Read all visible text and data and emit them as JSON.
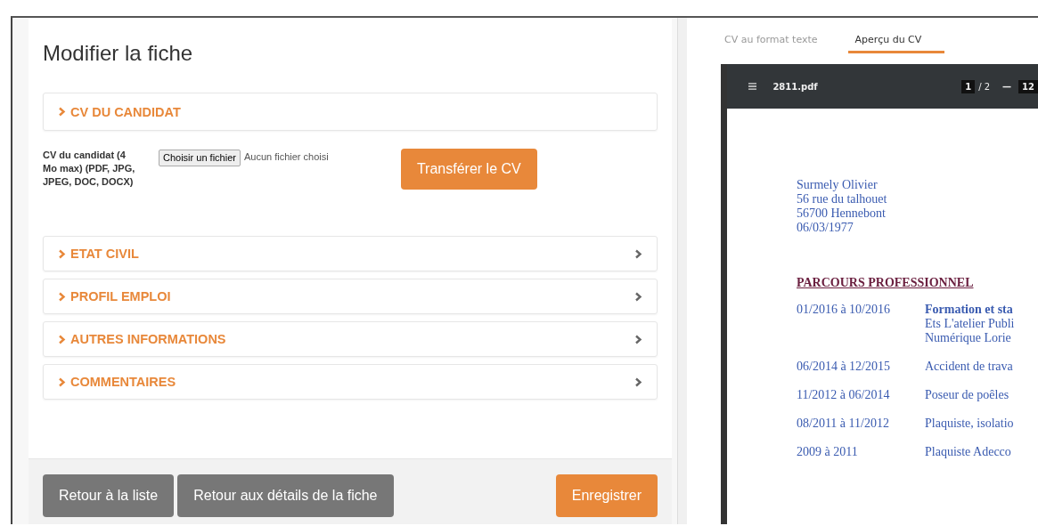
{
  "form": {
    "title": "Modifier la fiche",
    "sections": [
      {
        "label": "CV DU CANDIDAT",
        "expanded": true
      },
      {
        "label": "ETAT CIVIL",
        "expanded": false
      },
      {
        "label": "PROFIL EMPLOI",
        "expanded": false
      },
      {
        "label": "AUTRES INFORMATIONS",
        "expanded": false
      },
      {
        "label": "COMMENTAIRES",
        "expanded": false
      }
    ],
    "upload": {
      "label": "CV du candidat (4 Mo max) (PDF, JPG, JPEG, DOC, DOCX)",
      "choose_button": "Choisir un fichier",
      "file_status": "Aucun fichier choisi",
      "transfer_button": "Transférer le CV"
    },
    "footer_buttons": [
      {
        "label": "Retour à la liste",
        "kind": "secondary"
      },
      {
        "label": "Retour aux détails de la fiche",
        "kind": "secondary"
      },
      {
        "label": "Enregistrer",
        "kind": "primary"
      }
    ]
  },
  "preview": {
    "tabs": [
      {
        "label": "CV au format texte",
        "selected": false
      },
      {
        "label": "Aperçu du CV",
        "selected": true
      }
    ],
    "viewer": {
      "filename": "2811.pdf",
      "page": "1",
      "page_total": "/ 2",
      "zoom_out": "—",
      "zoom": "12"
    },
    "document": {
      "address": [
        "Surmely Olivier",
        "56 rue du talhouet",
        "56700 Hennebont",
        "06/03/1977"
      ],
      "heading": "PARCOURS PROFESSIONNEL",
      "entries": [
        {
          "dates": "01/2016 à 10/2016",
          "lines": [
            "**Formation et sta**",
            "Ets L'atelier Publi",
            "Numérique Lorie"
          ]
        },
        {
          "dates": "06/2014 à 12/2015",
          "lines": [
            "Accident de trava"
          ]
        },
        {
          "dates": "11/2012 à 06/2014",
          "lines": [
            "Poseur de poêles"
          ]
        },
        {
          "dates": "08/2011 à 11/2012",
          "lines": [
            "Plaquiste, isolatio"
          ]
        },
        {
          "dates": "2009 à 2011",
          "lines": [
            "Plaquiste Adecco"
          ]
        }
      ]
    }
  }
}
